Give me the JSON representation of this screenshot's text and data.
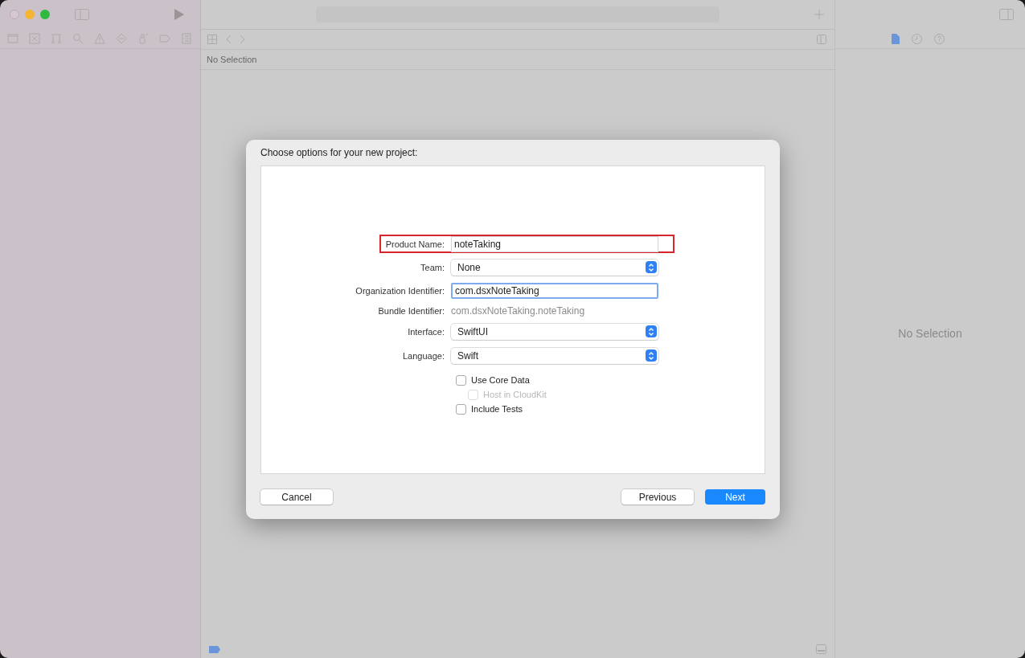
{
  "editor": {
    "jump_bar": "No Selection"
  },
  "inspector": {
    "empty_text": "No Selection"
  },
  "dialog": {
    "title": "Choose options for your new project:",
    "fields": [
      {
        "kind": "text",
        "label": "Product Name:",
        "value": "noteTaking",
        "highlighted": true,
        "focused": false
      },
      {
        "kind": "popup",
        "label": "Team:",
        "value": "None"
      },
      {
        "kind": "text",
        "label": "Organization Identifier:",
        "value": "com.dsxNoteTaking",
        "highlighted": false,
        "focused": true
      },
      {
        "kind": "static",
        "label": "Bundle Identifier:",
        "value": "com.dsxNoteTaking.noteTaking"
      },
      {
        "kind": "popup",
        "label": "Interface:",
        "value": "SwiftUI"
      },
      {
        "kind": "popup",
        "label": "Language:",
        "value": "Swift"
      }
    ],
    "checkboxes": [
      {
        "label": "Use Core Data",
        "checked": false,
        "disabled": false,
        "children": [
          {
            "label": "Host in CloudKit",
            "checked": false,
            "disabled": true
          }
        ]
      },
      {
        "label": "Include Tests",
        "checked": false,
        "disabled": false
      }
    ],
    "buttons": [
      {
        "label": "Cancel",
        "kind": "plain"
      },
      {
        "label": "Previous",
        "kind": "plain"
      },
      {
        "label": "Next",
        "kind": "default"
      }
    ]
  }
}
